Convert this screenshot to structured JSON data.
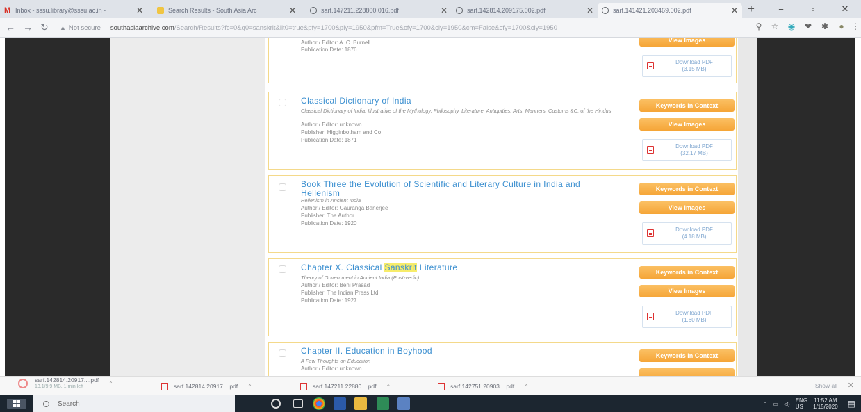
{
  "colors": {
    "link": "#3b8fd0",
    "button_orange": "#f5a537",
    "result_border": "#f4d98a",
    "highlight": "#f7ec6a",
    "taskbar": "#1c2630"
  },
  "browser": {
    "tabs": [
      {
        "title": "Inbox - sssu.library@sssu.ac.in -",
        "icon": "gmail-icon"
      },
      {
        "title": "Search Results - South Asia Arc",
        "icon": "sar-icon"
      },
      {
        "title": "sarf.147211.228800.016.pdf",
        "icon": "globe-icon"
      },
      {
        "title": "sarf.142814.209175.002.pdf",
        "icon": "globe-icon"
      },
      {
        "title": "sarf.141421.203469.002.pdf",
        "icon": "globe-icon"
      }
    ],
    "new_tab": "+",
    "window_controls": {
      "minimize": "−",
      "maximize": "▫",
      "close": "✕"
    },
    "address": {
      "security_label": "Not secure",
      "host": "southasiaarchive.com",
      "path": "/Search/Results?fc=0&q0=sanskrit&lit0=true&pfy=1700&ply=1950&pfm=True&cfy=1700&cly=1950&cm=False&cfy=1700&cly=1950"
    }
  },
  "results": [
    {
      "checked": false,
      "author": "Author / Editor: A. C. Burnell",
      "date": "Publication Date: 1876",
      "view_label": "View Images",
      "download_label": "Download PDF",
      "download_size": "(3.15 MB)"
    },
    {
      "title": "Classical Dictionary of India",
      "subtitle": "Classical Dictionary of India: Illustrative of the Mythology, Philosophy, Literature, Antiquities, Arts, Manners, Customs &C. of the Hindus",
      "author": "Author / Editor: unknown",
      "publisher": "Publisher: Higginbotham and Co",
      "date": "Publication Date: 1871",
      "kic_label": "Keywords in Context",
      "view_label": "View Images",
      "download_label": "Download PDF",
      "download_size": "(32.17 MB)"
    },
    {
      "title": "Book Three the Evolution of Scientific and Literary Culture in India and Hellenism",
      "subtitle": "Hellenism in Ancient India",
      "author": "Author / Editor: Gauranga Banerjee",
      "publisher": "Publisher: The Author",
      "date": "Publication Date: 1920",
      "kic_label": "Keywords in Context",
      "view_label": "View Images",
      "download_label": "Download PDF",
      "download_size": "(4.18 MB)"
    },
    {
      "title_pre": "Chapter X. Classical ",
      "title_hl": "Sanskrit",
      "title_post": " Literature",
      "subtitle": "Theory of Government in Ancient India (Post-vedic)",
      "author": "Author / Editor: Beni Prasad",
      "publisher": "Publisher: The Indian Press Ltd",
      "date": "Publication Date: 1927",
      "kic_label": "Keywords in Context",
      "view_label": "View Images",
      "download_label": "Download PDF",
      "download_size": "(1.60 MB)"
    },
    {
      "title": "Chapter II. Education in Boyhood",
      "subtitle": "A Few Thoughts on Education",
      "author": "Author / Editor: unknown",
      "kic_label": "Keywords in Context"
    }
  ],
  "downloads": {
    "items": [
      {
        "name": "sarf.142814.20917....pdf",
        "status": "13.1/9.9 MB, 1 min left"
      },
      {
        "name": "sarf.142814.20917....pdf"
      },
      {
        "name": "sarf.147211.22880....pdf"
      },
      {
        "name": "sarf.142751.20903....pdf"
      }
    ],
    "show_all": "Show all",
    "close": "✕"
  },
  "taskbar": {
    "search_placeholder": "Search",
    "tray": {
      "lang": "ENG",
      "region": "US",
      "time": "11:52 AM",
      "date": "1/15/2020"
    }
  }
}
